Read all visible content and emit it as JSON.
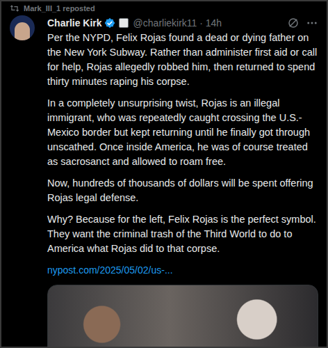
{
  "repost": {
    "text": "Mark_III_1 reposted"
  },
  "author": {
    "name": "Charlie Kirk",
    "verified": true,
    "affiliated": true,
    "meta": "@charliekirk11 · 14h"
  },
  "paragraphs": [
    "Per the NYPD, Felix Rojas found a dead or dying father on the New York Subway. Rather than administer first aid or call for help, Rojas allegedly robbed him, then returned to spend thirty minutes raping his corpse.",
    "In a completely unsurprising twist, Rojas is an illegal immigrant, who was repeatedly caught crossing the U.S.-Mexico border but kept returning until he finally got through unscathed. Once inside America, he was of course treated as sacrosanct and allowed to roam free.",
    "Now, hundreds of thousands of dollars will be spent offering Rojas legal defense.",
    "Why? Because for the left, Felix Rojas is the perfect symbol. They want the criminal trash of the Third World to do to America what Rojas did to that corpse."
  ],
  "link": "nypost.com/2025/05/02/us-..."
}
